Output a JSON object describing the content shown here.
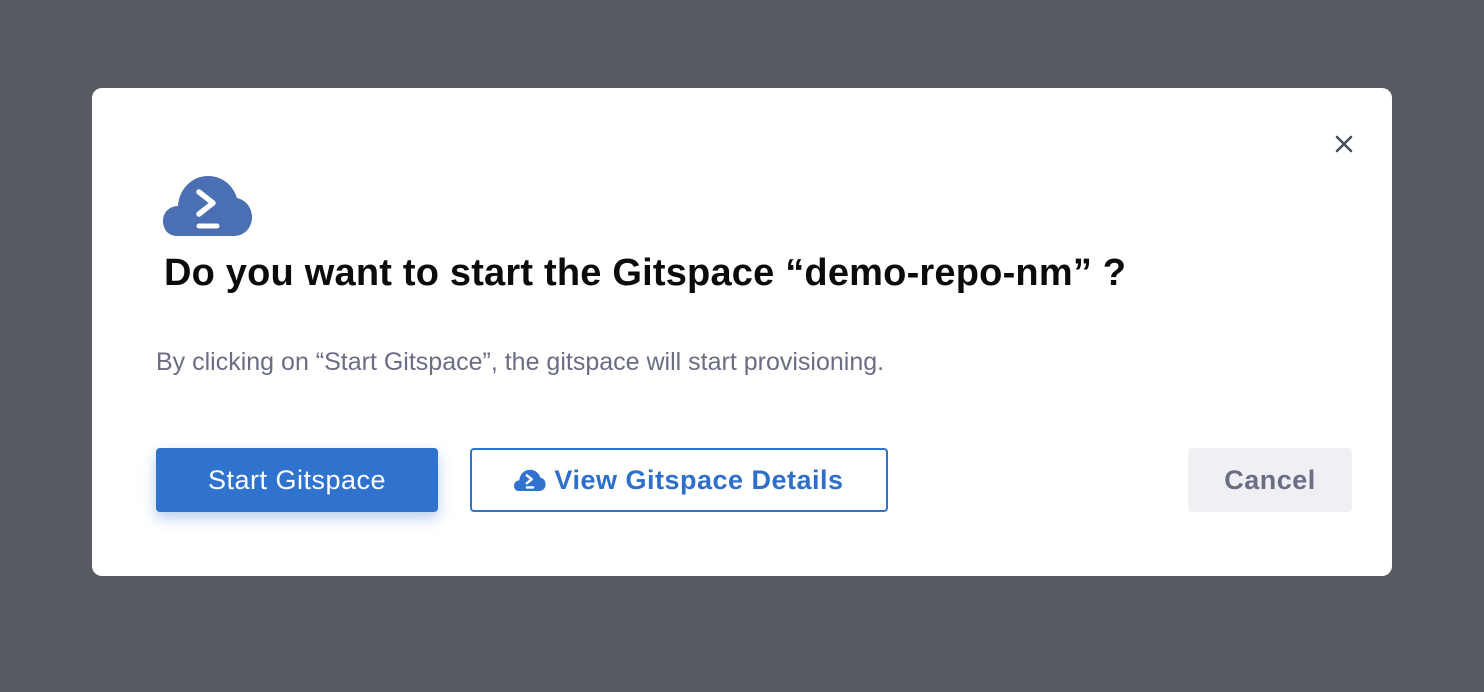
{
  "dialog": {
    "title": "Do you want to start the Gitspace “demo-repo-nm” ?",
    "subtitle": "By clicking on “Start Gitspace”, the gitspace will start provisioning.",
    "logo_icon": "gitspace-cloud-icon",
    "close_icon": "close-icon"
  },
  "actions": {
    "start_label": "Start Gitspace",
    "details_label": "View Gitspace Details",
    "details_icon": "gitspace-cloud-icon",
    "cancel_label": "Cancel"
  },
  "colors": {
    "overlay": "#575b61",
    "primary": "#3073cf",
    "logo": "#4a6fb3",
    "text_dark": "#0b0b0d",
    "text_muted": "#6b6d85",
    "cancel_bg": "#f0f0f4"
  }
}
